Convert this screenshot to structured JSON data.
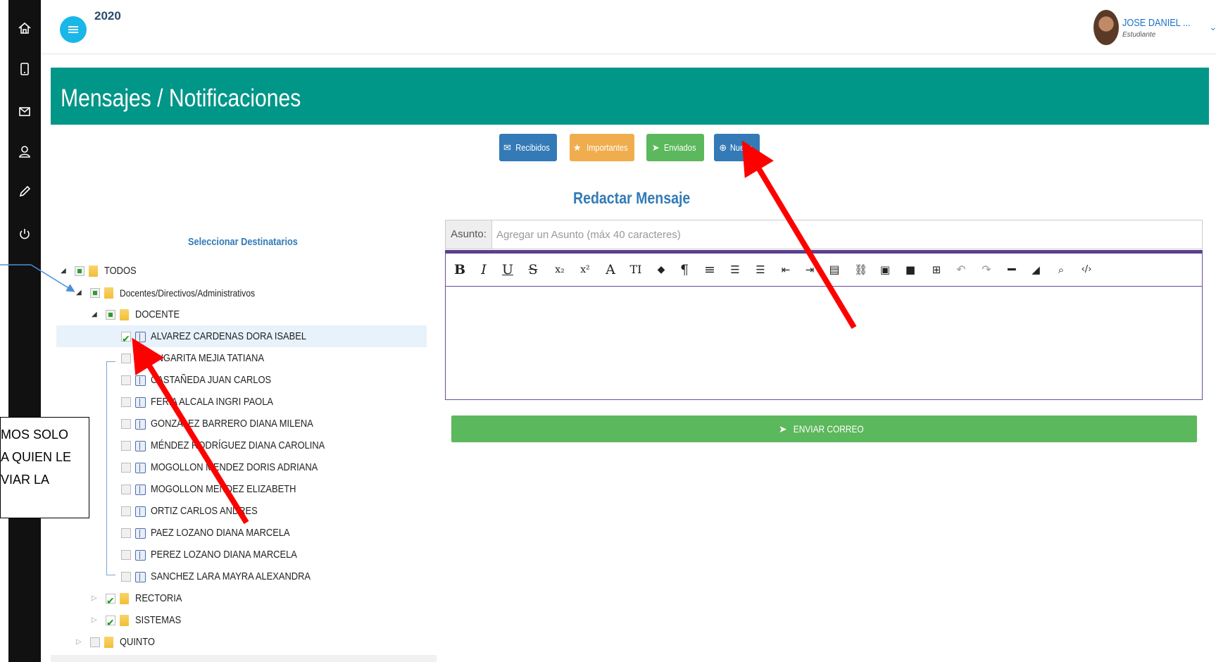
{
  "top": {
    "year": "2020",
    "user_name": "JOSE DANIEL ...",
    "user_role": "Estudiante"
  },
  "sidebar_icons": [
    "home-icon",
    "mobile-icon",
    "mail-icon",
    "user-icon",
    "pencil-icon",
    "power-icon"
  ],
  "header": {
    "title": "Mensajes / Notificaciones"
  },
  "actions": [
    {
      "label": "Recibidos",
      "icon": "envelope-icon"
    },
    {
      "label": "Importantes",
      "icon": "star-icon"
    },
    {
      "label": "Enviados",
      "icon": "send-icon"
    },
    {
      "label": "Nuevo",
      "icon": "plus-circle-icon"
    }
  ],
  "compose": {
    "title": "Redactar Mensaje",
    "subject_label": "Asunto:",
    "subject_placeholder": "Agregar un Asunto (máx 40 caracteres)",
    "send_label": "ENVIAR CORREO"
  },
  "toolbar": [
    "B",
    "I",
    "U",
    "S",
    "x₂",
    "x²",
    "A",
    "TI",
    "◆",
    "¶",
    "≡",
    "list-ol",
    "list-ul",
    "outdent",
    "indent",
    "file",
    "link",
    "image",
    "video",
    "table",
    "undo",
    "redo",
    "hr",
    "eraser",
    "attach",
    "code"
  ],
  "recipients": {
    "title": "Seleccionar Destinatarios",
    "tree": [
      {
        "label": "TODOS",
        "level": 0,
        "type": "folder",
        "state": "partial",
        "expander": "open"
      },
      {
        "label": "Docentes/Directivos/Administrativos",
        "level": 1,
        "type": "folder",
        "state": "partial",
        "expander": "open"
      },
      {
        "label": "DOCENTE",
        "level": 2,
        "type": "folder",
        "state": "partial",
        "expander": "open"
      },
      {
        "label": "ALVAREZ CARDENAS DORA ISABEL",
        "level": 3,
        "type": "person",
        "state": "checked"
      },
      {
        "label": "ANGARITA MEJIA TATIANA",
        "level": 3,
        "type": "person",
        "state": "unchecked"
      },
      {
        "label": "CASTAÑEDA JUAN CARLOS",
        "level": 3,
        "type": "person",
        "state": "unchecked"
      },
      {
        "label": "FERIA ALCALA INGRI PAOLA",
        "level": 3,
        "type": "person",
        "state": "unchecked"
      },
      {
        "label": "GONZALEZ BARRERO DIANA MILENA",
        "level": 3,
        "type": "person",
        "state": "unchecked"
      },
      {
        "label": "MÉNDEZ RODRÍGUEZ DIANA CAROLINA",
        "level": 3,
        "type": "person",
        "state": "unchecked"
      },
      {
        "label": "MOGOLLON MENDEZ DORIS ADRIANA",
        "level": 3,
        "type": "person",
        "state": "unchecked"
      },
      {
        "label": "MOGOLLON MENDEZ ELIZABETH",
        "level": 3,
        "type": "person",
        "state": "unchecked"
      },
      {
        "label": "ORTIZ CARLOS ANDRES",
        "level": 3,
        "type": "person",
        "state": "unchecked"
      },
      {
        "label": "PAEZ LOZANO DIANA MARCELA",
        "level": 3,
        "type": "person",
        "state": "unchecked"
      },
      {
        "label": "PEREZ LOZANO DIANA MARCELA",
        "level": 3,
        "type": "person",
        "state": "unchecked"
      },
      {
        "label": "SANCHEZ LARA MAYRA ALEXANDRA",
        "level": 3,
        "type": "person",
        "state": "unchecked"
      },
      {
        "label": "RECTORIA",
        "level": 2,
        "type": "folder",
        "state": "checked",
        "expander": "closed"
      },
      {
        "label": "SISTEMAS",
        "level": 2,
        "type": "folder",
        "state": "checked",
        "expander": "closed"
      },
      {
        "label": "QUINTO",
        "level": 1,
        "type": "folder",
        "state": "unchecked",
        "expander": "closed"
      }
    ]
  },
  "annotation": {
    "lines": [
      "MOS SOLO",
      "A QUIEN LE",
      "VIAR LA"
    ]
  }
}
